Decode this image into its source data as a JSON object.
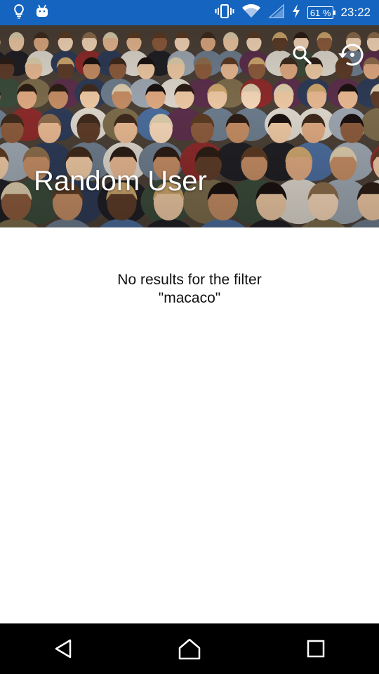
{
  "status_bar": {
    "time": "23:22",
    "battery": "61 %",
    "icons": [
      "lightbulb-icon",
      "android-icon",
      "vibrate-icon",
      "wifi-icon",
      "signal-icon",
      "charging-icon"
    ],
    "color": "#1565c0"
  },
  "header": {
    "title": "Random User",
    "actions": [
      "search-icon",
      "restore-icon"
    ]
  },
  "content": {
    "empty_message_line1": "No results for the filter",
    "empty_message_line2": "\"macaco\""
  },
  "nav_bar": {
    "buttons": [
      "back-icon",
      "home-icon",
      "recents-icon"
    ]
  }
}
